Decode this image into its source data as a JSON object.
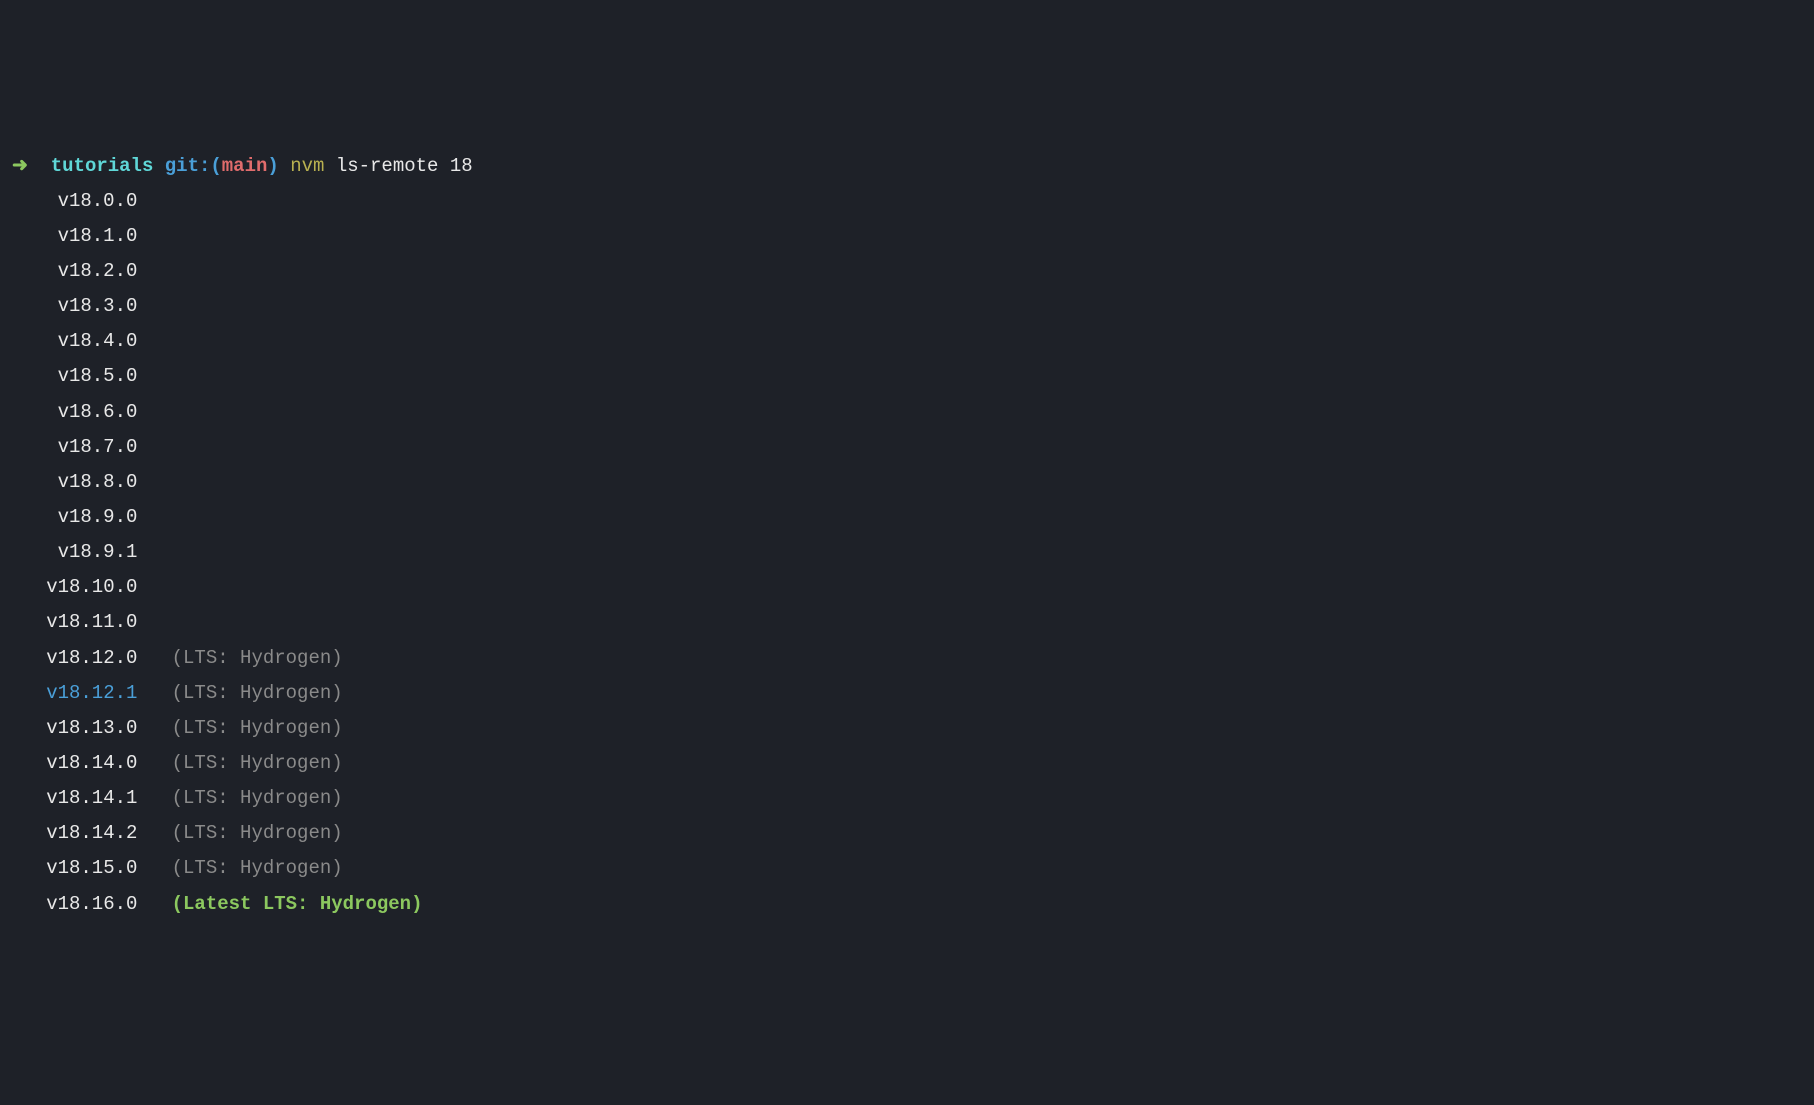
{
  "prompt": {
    "arrow": "➜",
    "directory": "tutorials",
    "git_label": "git:(",
    "branch": "main",
    "git_close": ")",
    "command_bin": "nvm",
    "command_args": "ls-remote 18"
  },
  "output": [
    {
      "version": "v18.0.0",
      "label": "",
      "style": "white"
    },
    {
      "version": "v18.1.0",
      "label": "",
      "style": "white"
    },
    {
      "version": "v18.2.0",
      "label": "",
      "style": "white"
    },
    {
      "version": "v18.3.0",
      "label": "",
      "style": "white"
    },
    {
      "version": "v18.4.0",
      "label": "",
      "style": "white"
    },
    {
      "version": "v18.5.0",
      "label": "",
      "style": "white"
    },
    {
      "version": "v18.6.0",
      "label": "",
      "style": "white"
    },
    {
      "version": "v18.7.0",
      "label": "",
      "style": "white"
    },
    {
      "version": "v18.8.0",
      "label": "",
      "style": "white"
    },
    {
      "version": "v18.9.0",
      "label": "",
      "style": "white"
    },
    {
      "version": "v18.9.1",
      "label": "",
      "style": "white"
    },
    {
      "version": "v18.10.0",
      "label": "",
      "style": "white"
    },
    {
      "version": "v18.11.0",
      "label": "",
      "style": "white"
    },
    {
      "version": "v18.12.0",
      "label": "(LTS: Hydrogen)",
      "style": "white",
      "labelStyle": "dim"
    },
    {
      "version": "v18.12.1",
      "label": "(LTS: Hydrogen)",
      "style": "selected",
      "labelStyle": "dim"
    },
    {
      "version": "v18.13.0",
      "label": "(LTS: Hydrogen)",
      "style": "white",
      "labelStyle": "dim"
    },
    {
      "version": "v18.14.0",
      "label": "(LTS: Hydrogen)",
      "style": "white",
      "labelStyle": "dim"
    },
    {
      "version": "v18.14.1",
      "label": "(LTS: Hydrogen)",
      "style": "white",
      "labelStyle": "dim"
    },
    {
      "version": "v18.14.2",
      "label": "(LTS: Hydrogen)",
      "style": "white",
      "labelStyle": "dim"
    },
    {
      "version": "v18.15.0",
      "label": "(LTS: Hydrogen)",
      "style": "white",
      "labelStyle": "dim"
    },
    {
      "version": "v18.16.0",
      "label": "(Latest LTS: Hydrogen)",
      "style": "white",
      "labelStyle": "green"
    }
  ]
}
